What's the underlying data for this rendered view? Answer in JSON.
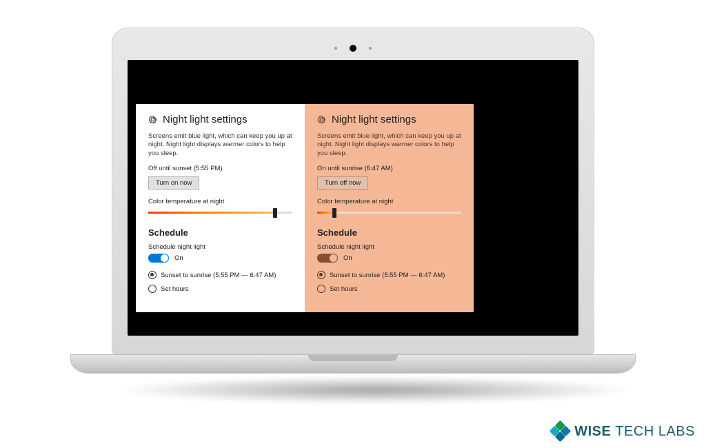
{
  "brand": {
    "name_bold": "WISE",
    "name_thin": "TECH LABS"
  },
  "panels": {
    "left": {
      "title": "Night light settings",
      "description": "Screens emit blue light, which can keep you up at night. Night light displays warmer colors to help you sleep.",
      "status": "Off until sunset (5:55 PM)",
      "button": "Turn on now",
      "temp_label": "Color temperature at night",
      "slider_percent": 88,
      "schedule_heading": "Schedule",
      "schedule_label": "Schedule night light",
      "toggle_state": "On",
      "radio_sunset": "Sunset to sunrise (5:55 PM — 6:47 AM)",
      "radio_sethours": "Set hours"
    },
    "right": {
      "title": "Night light settings",
      "description": "Screens emit blue light, which can keep you up at night. Night light displays warmer colors to help you sleep.",
      "status": "On until sunrise (6:47 AM)",
      "button": "Turn off now",
      "temp_label": "Color temperature at night",
      "slider_percent": 12,
      "schedule_heading": "Schedule",
      "schedule_label": "Schedule night light",
      "toggle_state": "On",
      "radio_sunset": "Sunset to sunrise (5:55 PM — 6:47 AM)",
      "radio_sethours": "Set hours"
    }
  }
}
